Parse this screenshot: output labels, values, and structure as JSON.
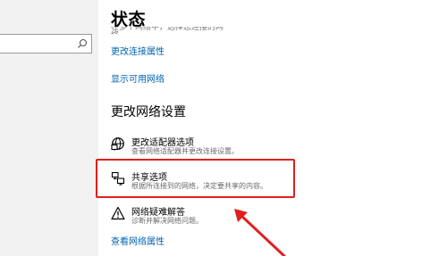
{
  "left_pane": {
    "search": {
      "value": "",
      "placeholder": ""
    }
  },
  "status_page": {
    "title": "状态",
    "truncated_text": "在多个网络中，选择您连接的网络。",
    "links": {
      "change_connection_properties": "更改连接属性",
      "show_available_networks": "显示可用网络",
      "view_network_properties": "查看网络属性"
    },
    "section_heading": "更改网络设置",
    "options": [
      {
        "title": "更改适配器选项",
        "desc": "查看网络适配器并更改连接设置。"
      },
      {
        "title": "共享选项",
        "desc": "根据所连接到的网络，决定要共享的内容。"
      },
      {
        "title": "网络疑难解答",
        "desc": "诊断并解决网络问题。"
      }
    ]
  },
  "annotation": {
    "color": "#e02020"
  }
}
